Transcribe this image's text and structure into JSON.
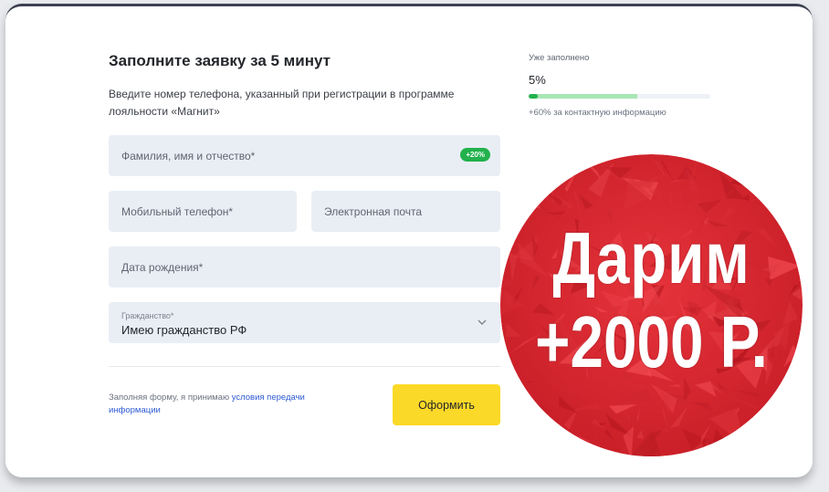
{
  "form": {
    "title": "Заполните заявку за 5 минут",
    "subtitle": "Введите номер телефона, указанный при регистрации в программе лояльности «Магнит»",
    "fields": {
      "full_name": {
        "placeholder": "Фамилия, имя и отчество*",
        "badge": "+20%"
      },
      "phone": {
        "placeholder": "Мобильный телефон*"
      },
      "email": {
        "placeholder": "Электронная почта"
      },
      "birthdate": {
        "placeholder": "Дата рождения*"
      },
      "citizenship": {
        "label": "Гражданство*",
        "value": "Имею гражданство РФ"
      }
    },
    "consent_text": "Заполняя форму, я принимаю ",
    "consent_link": "условия передачи информации",
    "submit_label": "Оформить"
  },
  "progress": {
    "label": "Уже заполнено",
    "percent_text": "5%",
    "percent": 5,
    "potential_percent": 60,
    "note": "+60% за контактную информацию"
  },
  "promo": {
    "line1": "Дарим",
    "line2": "+2000 Р.",
    "color": "#d8242e"
  },
  "colors": {
    "accent_green": "#22b14c",
    "submit_yellow": "#fbd928",
    "link_blue": "#2f5bd3"
  }
}
